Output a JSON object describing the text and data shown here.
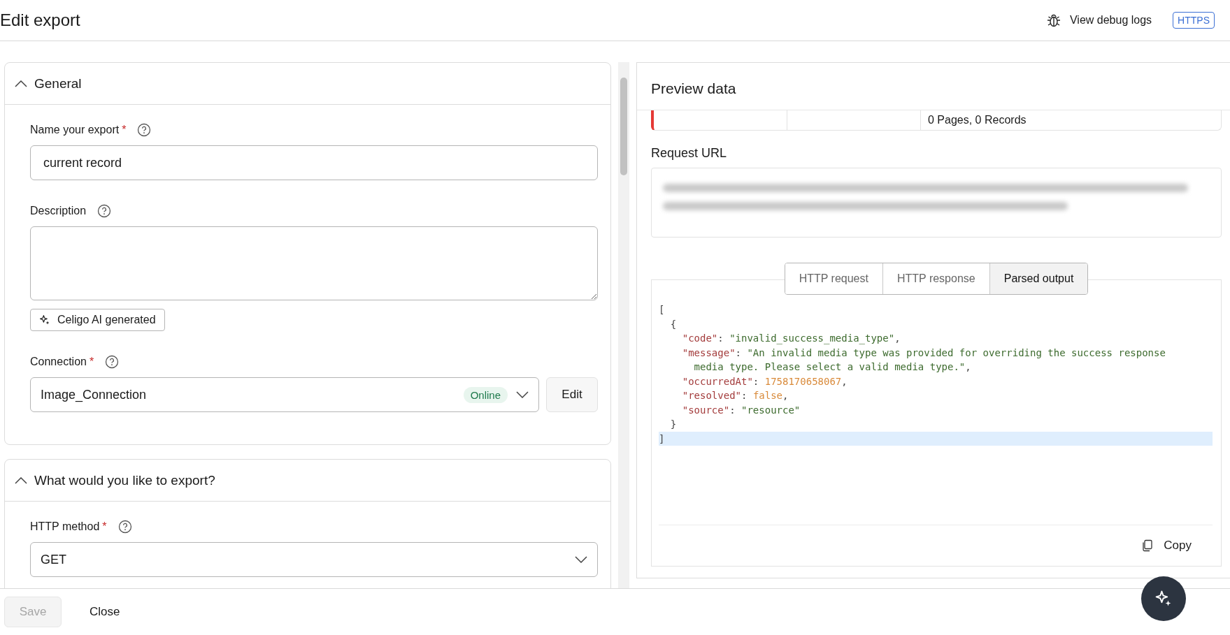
{
  "header": {
    "title": "Edit export",
    "debug_link": "View debug logs",
    "badge": "HTTPS"
  },
  "sections": [
    {
      "title": "General",
      "expanded": true,
      "fields": [
        {
          "kind": "text",
          "label": "Name your export",
          "required_mark": "*",
          "value": "current record"
        },
        {
          "kind": "textarea",
          "label": "Description",
          "button": "Celigo AI generated"
        },
        {
          "kind": "connection",
          "label": "Connection",
          "required_mark": "*",
          "value": "Image_Connection",
          "status": "Online",
          "button": "Edit"
        }
      ]
    },
    {
      "title": "What would you like to export?",
      "expanded": true,
      "fields": [
        {
          "kind": "select",
          "label": "HTTP method",
          "required_mark": "*",
          "value": "GET"
        }
      ]
    }
  ],
  "preview": {
    "title": "Preview data",
    "summary": "0 Pages, 0 Records",
    "url_label": "Request URL",
    "tabs": [
      {
        "label": "HTTP request",
        "selected": false
      },
      {
        "label": "HTTP response",
        "selected": false
      },
      {
        "label": "Parsed output",
        "selected": true
      }
    ],
    "code_lines": [
      {
        "current": false,
        "tokens": [
          {
            "kind": "punct",
            "text": "["
          }
        ]
      },
      {
        "current": false,
        "tokens": [
          {
            "kind": "punct",
            "text": "  {"
          }
        ]
      },
      {
        "current": false,
        "tokens": [
          {
            "kind": "key",
            "text": "    \"code\""
          },
          {
            "kind": "punct",
            "text": ": "
          },
          {
            "kind": "string",
            "text": "\"invalid_success_media_type\""
          },
          {
            "kind": "punct",
            "text": ","
          }
        ]
      },
      {
        "current": false,
        "tokens": [
          {
            "kind": "key",
            "text": "    \"message\""
          },
          {
            "kind": "punct",
            "text": ": "
          },
          {
            "kind": "string",
            "text": "\"An invalid media type was provided for overriding the success response"
          }
        ]
      },
      {
        "current": false,
        "tokens": [
          {
            "kind": "string",
            "text": "      media type. Please select a valid media type.\""
          },
          {
            "kind": "punct",
            "text": ","
          }
        ]
      },
      {
        "current": false,
        "tokens": [
          {
            "kind": "key",
            "text": "    \"occurredAt\""
          },
          {
            "kind": "punct",
            "text": ": "
          },
          {
            "kind": "number",
            "text": "1758170658067"
          },
          {
            "kind": "punct",
            "text": ","
          }
        ]
      },
      {
        "current": false,
        "tokens": [
          {
            "kind": "key",
            "text": "    \"resolved\""
          },
          {
            "kind": "punct",
            "text": ": "
          },
          {
            "kind": "boolean",
            "text": "false"
          },
          {
            "kind": "punct",
            "text": ","
          }
        ]
      },
      {
        "current": false,
        "tokens": [
          {
            "kind": "key",
            "text": "    \"source\""
          },
          {
            "kind": "punct",
            "text": ": "
          },
          {
            "kind": "string",
            "text": "\"resource\""
          }
        ]
      },
      {
        "current": false,
        "tokens": [
          {
            "kind": "punct",
            "text": "  }"
          }
        ]
      },
      {
        "current": true,
        "tokens": [
          {
            "kind": "punct",
            "text": "]"
          }
        ]
      }
    ],
    "copy": "Copy"
  },
  "footer": {
    "save": {
      "label": "Save",
      "disabled": true
    },
    "close": "Close"
  }
}
